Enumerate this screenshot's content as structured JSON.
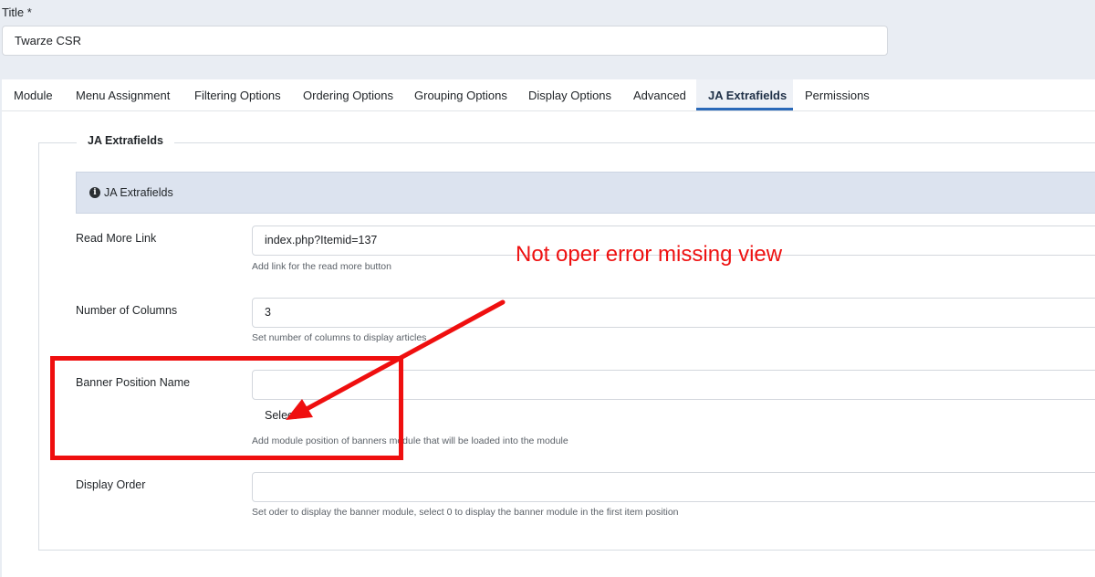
{
  "title_field": {
    "label": "Title *",
    "value": "Twarze CSR"
  },
  "tabs": [
    {
      "label": "Module"
    },
    {
      "label": "Menu Assignment"
    },
    {
      "label": "Filtering Options"
    },
    {
      "label": "Ordering Options"
    },
    {
      "label": "Grouping Options"
    },
    {
      "label": "Display Options"
    },
    {
      "label": "Advanced"
    },
    {
      "label": "JA Extrafields",
      "active": true
    },
    {
      "label": "Permissions"
    }
  ],
  "fieldset": {
    "legend": "JA Extrafields",
    "alert": {
      "icon": "info-circle-icon",
      "text": "JA Extrafields"
    },
    "fields": {
      "read_more": {
        "label": "Read More Link",
        "value": "index.php?Itemid=137",
        "desc": "Add link for the read more button"
      },
      "columns": {
        "label": "Number of Columns",
        "value": "3",
        "desc": "Set number of columns to display articles"
      },
      "banner_position": {
        "label": "Banner Position Name",
        "value": "",
        "select_text": "Select",
        "desc": "Add module position of banners module that will be loaded into the module"
      },
      "display_order": {
        "label": "Display Order",
        "value": "",
        "desc": "Set oder to display the banner module, select 0 to display the banner module in the first item position"
      }
    }
  },
  "annotation": {
    "text": "Not oper error missing view",
    "color": "#ee1111"
  },
  "colors": {
    "accent": "#2a69b8",
    "page_bg": "#e9edf3",
    "alert_bg": "#dce3ef"
  }
}
